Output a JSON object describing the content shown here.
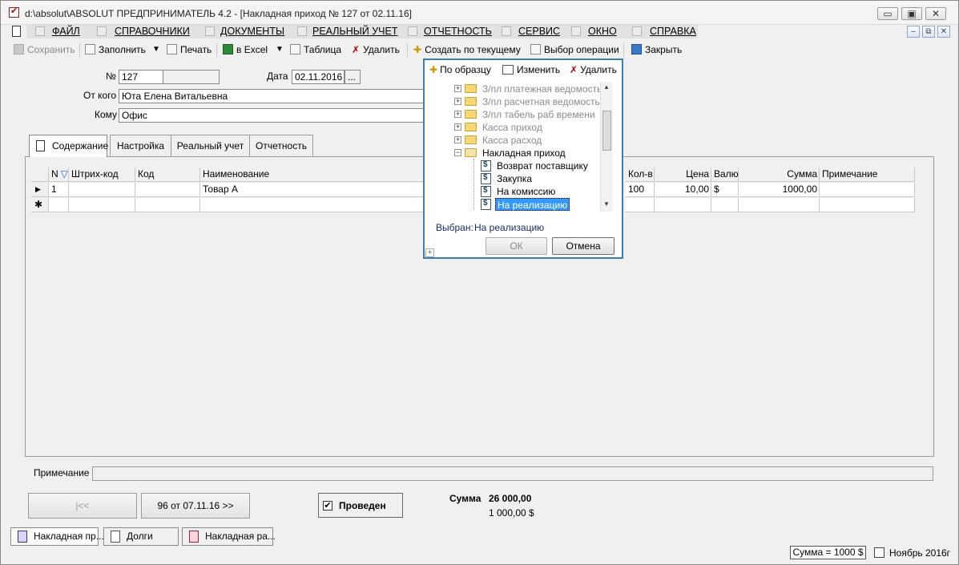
{
  "window": {
    "title": "d:\\absolut\\ABSOLUT  ПРЕДПРИНИМАТЕЛЬ 4.2 - [Накладная приход № 127 от 02.11.16]",
    "controls": [
      "▭",
      "▣",
      "✕"
    ]
  },
  "menu": {
    "items": [
      "ФАЙЛ",
      "СПРАВОЧНИКИ",
      "ДОКУМЕНТЫ",
      "РЕАЛЬНЫЙ УЧЕТ",
      "ОТЧЕТНОСТЬ",
      "СЕРВИС",
      "ОКНО",
      "СПРАВКА"
    ],
    "mdi_controls": [
      "–",
      "⧉",
      "✕"
    ]
  },
  "toolbar": {
    "save": "Сохранить",
    "fill": "Заполнить",
    "print": "Печать",
    "excel": "в Excel",
    "table": "Таблица",
    "delete": "Удалить",
    "create_current": "Создать по текущему",
    "select_operation": "Выбор операции",
    "close": "Закрыть"
  },
  "form": {
    "number_label": "№",
    "number": "127",
    "date_label": "Дата",
    "date": "02.11.2016",
    "date_btn": "...",
    "from_label": "От кого",
    "from": "Юта Елена Витальевна",
    "to_label": "Кому",
    "to": "Офис"
  },
  "tabs": [
    "Содержание",
    "Настройка",
    "Реальный учет",
    "Отчетность"
  ],
  "grid": {
    "headers": {
      "num": "N",
      "barcode": "Штрих-код",
      "code": "Код",
      "name": "Наименование",
      "qty": "Кол-в",
      "price": "Цена",
      "currency": "Валю",
      "sum": "Сумма",
      "note": "Примечание"
    },
    "rows": [
      {
        "num": "1",
        "barcode": "",
        "code": "",
        "name": "Товар А",
        "qty": "100",
        "price": "10,00",
        "currency": "$",
        "sum": "1000,00",
        "note": ""
      }
    ],
    "new_row_marker": "✱",
    "current_row_marker": "▶"
  },
  "popup": {
    "toolbar": {
      "by_sample": "По образцу",
      "edit": "Изменить",
      "delete": "Удалить"
    },
    "tree": [
      {
        "label": "З/пл платежная ведомость",
        "type": "folder",
        "expandable": true,
        "enabled": false
      },
      {
        "label": "З/пл расчетная ведомость",
        "type": "folder",
        "expandable": true,
        "enabled": false
      },
      {
        "label": "З/пл табель раб времени",
        "type": "folder",
        "expandable": true,
        "enabled": false
      },
      {
        "label": "Касса приход",
        "type": "folder",
        "expandable": true,
        "enabled": false
      },
      {
        "label": "Касса расход",
        "type": "folder",
        "expandable": true,
        "enabled": false
      },
      {
        "label": "Накладная приход",
        "type": "folder",
        "expanded": true,
        "enabled": true
      },
      {
        "label": "Возврат поставщику",
        "type": "doc"
      },
      {
        "label": "Закупка",
        "type": "doc"
      },
      {
        "label": "На комиссию",
        "type": "doc"
      },
      {
        "label": "На реализацию",
        "type": "doc",
        "selected": true
      }
    ],
    "selected_label": "Выбран:",
    "selected_value": "На реализацию",
    "ok": "ОК",
    "cancel": "Отмена"
  },
  "footer": {
    "note_label": "Примечание",
    "nav_first": "|<<",
    "nav_next": "96 от 07.11.16 >>",
    "posted": "Проведен",
    "posted_checked": true,
    "sum_label": "Сумма",
    "sum_value": "26 000,00",
    "sum_currency": "1 000,00 $"
  },
  "tasks": [
    "Накладная пр...",
    "Долги",
    "Накладная ра..."
  ],
  "status": {
    "sum": "Сумма = 1000 $",
    "period": "Ноябрь 2016г"
  },
  "colors": {
    "selection": "#3399ff",
    "popup_border": "#3c7fb1",
    "menu_strip": "#e2e2e2"
  }
}
